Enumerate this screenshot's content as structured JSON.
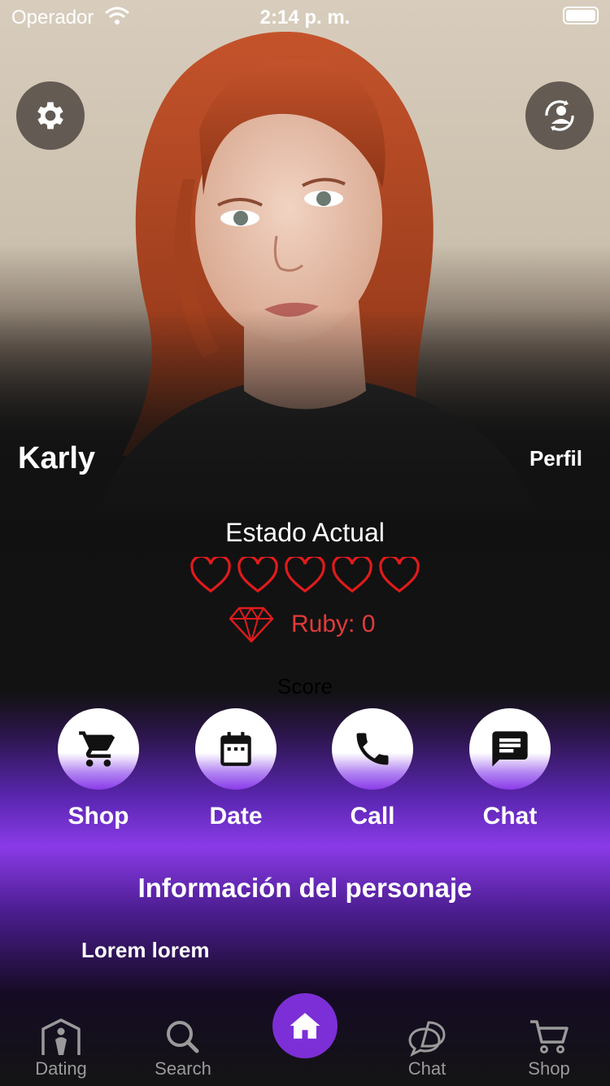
{
  "status_bar": {
    "carrier": "Operador",
    "time": "2:14 p. m."
  },
  "character": {
    "name": "Karly",
    "profile_link": "Perfil"
  },
  "status": {
    "title": "Estado Actual",
    "hearts_total": 5,
    "hearts_filled": 0,
    "ruby_label": "Ruby: 0",
    "score_label": "Score"
  },
  "actions": [
    {
      "label": "Shop",
      "icon": "cart-icon"
    },
    {
      "label": "Date",
      "icon": "calendar-icon"
    },
    {
      "label": "Call",
      "icon": "phone-icon"
    },
    {
      "label": "Chat",
      "icon": "chat-bubble-icon"
    }
  ],
  "info": {
    "title": "Información del personaje",
    "body": "Lorem lorem"
  },
  "tabbar": {
    "items": [
      {
        "label": "Dating",
        "icon": "person-house-icon"
      },
      {
        "label": "Search",
        "icon": "search-icon"
      },
      {
        "label": "",
        "icon": "home-icon"
      },
      {
        "label": "Chat",
        "icon": "chat-icon"
      },
      {
        "label": "Shop",
        "icon": "cart-icon"
      }
    ]
  },
  "colors": {
    "accent": "#7c2fd6",
    "heart": "#e01b1b",
    "ruby": "#e23a3a"
  }
}
